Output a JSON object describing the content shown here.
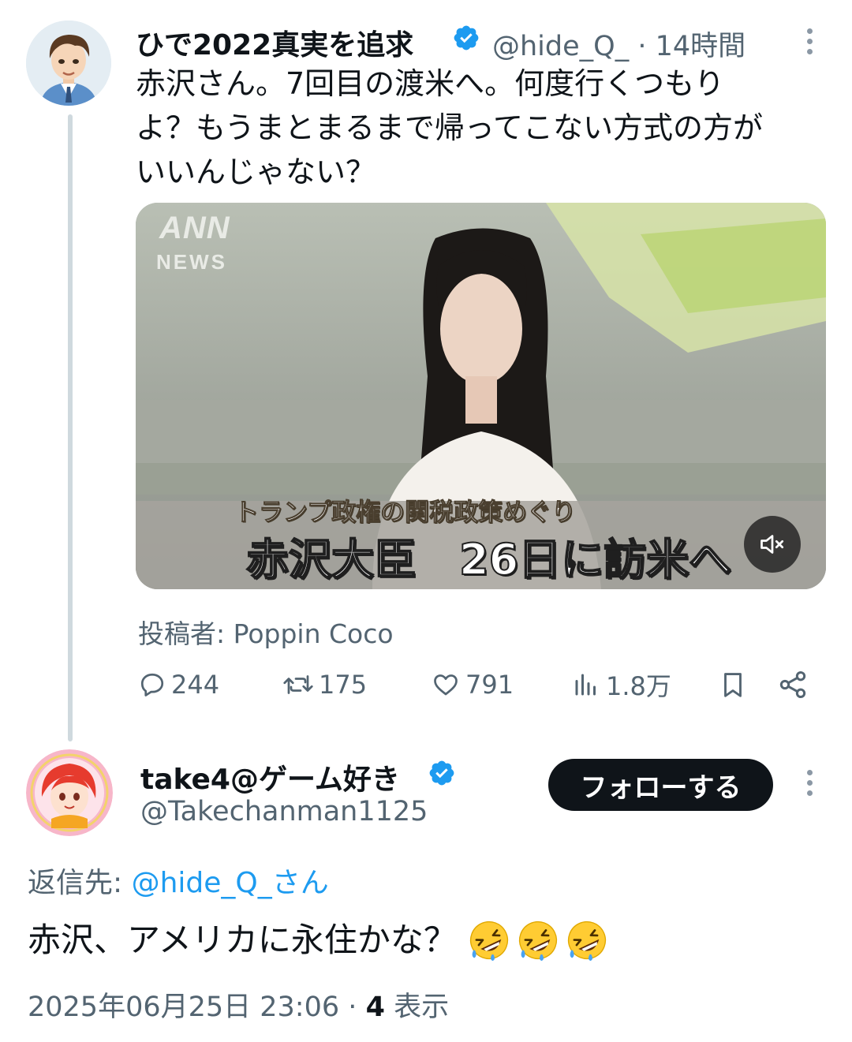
{
  "main_tweet": {
    "display_name": "ひで2022真実を追求",
    "handle": "@hide_Q_",
    "separator": "·",
    "time": "14時間",
    "text": "赤沢さん。7回目の渡米へ。何度行くつもり\nよ？もうまとまるまで帰ってこない方式の方が\nいいんじゃない？",
    "video": {
      "logo_top": "ANN",
      "logo_bottom": "NEWS",
      "caption_sub": "トランプ政権の関税政策めぐり",
      "caption_main": "赤沢大臣　26日に訪米へ"
    },
    "attribution": "投稿者: Poppin Coco",
    "stats": {
      "replies": "244",
      "reposts": "175",
      "likes": "791",
      "views": "1.8万"
    }
  },
  "reply_tweet": {
    "display_name": "take4@ゲーム好き",
    "handle": "@Takechanman1125",
    "follow_label": "フォローする",
    "reply_to_label": "返信先:",
    "reply_to_mention": "@hide_Q_さん",
    "text": "赤沢、アメリカに永住かな？",
    "emoji_count": 3,
    "timestamp": "2025年06月25日 23:06",
    "separator": "·",
    "views_count": "4",
    "views_label": "表示"
  },
  "colors": {
    "text_primary": "#0f1419",
    "text_secondary": "#536471",
    "link": "#1d9bf0",
    "verified": "#1d9bf0",
    "thread_line": "#cfd9de",
    "follow_button_bg": "#0f1419"
  },
  "icons": [
    "verified-badge-icon",
    "more-icon",
    "reply-icon",
    "repost-icon",
    "like-icon",
    "views-icon",
    "bookmark-icon",
    "share-icon",
    "mute-icon",
    "rofl-emoji"
  ]
}
